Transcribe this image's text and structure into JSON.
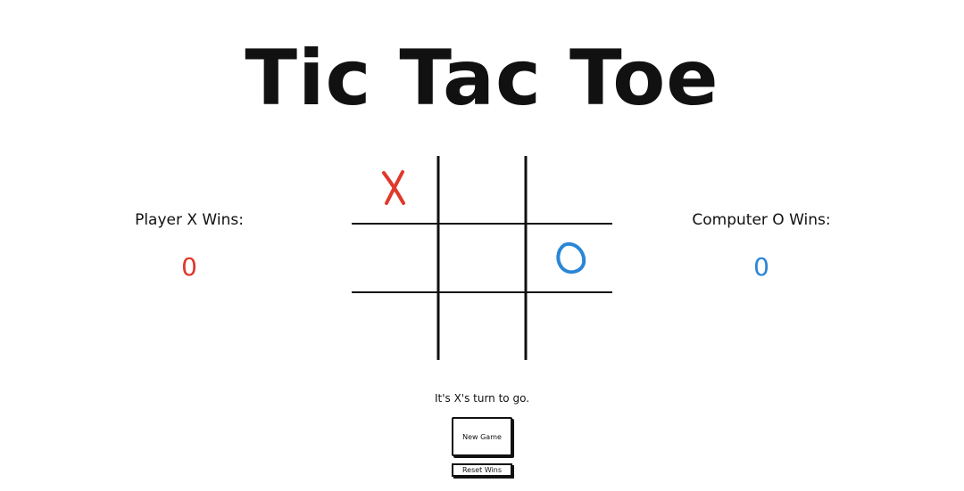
{
  "title": "Tic Tac Toe",
  "scores": {
    "player": {
      "label": "Player X Wins:",
      "count": "0",
      "color": "#e0382b"
    },
    "computer": {
      "label": "Computer O Wins:",
      "count": "0",
      "color": "#2a86d6"
    }
  },
  "board": {
    "cells": [
      "X",
      "",
      "",
      "",
      "",
      "O",
      "",
      "",
      ""
    ]
  },
  "status": "It's X's turn to go.",
  "buttons": {
    "new_game": "New Game",
    "reset_wins": "Reset Wins"
  },
  "colors": {
    "x_mark": "#e0382b",
    "o_mark": "#2a86d6",
    "grid": "#111111"
  }
}
